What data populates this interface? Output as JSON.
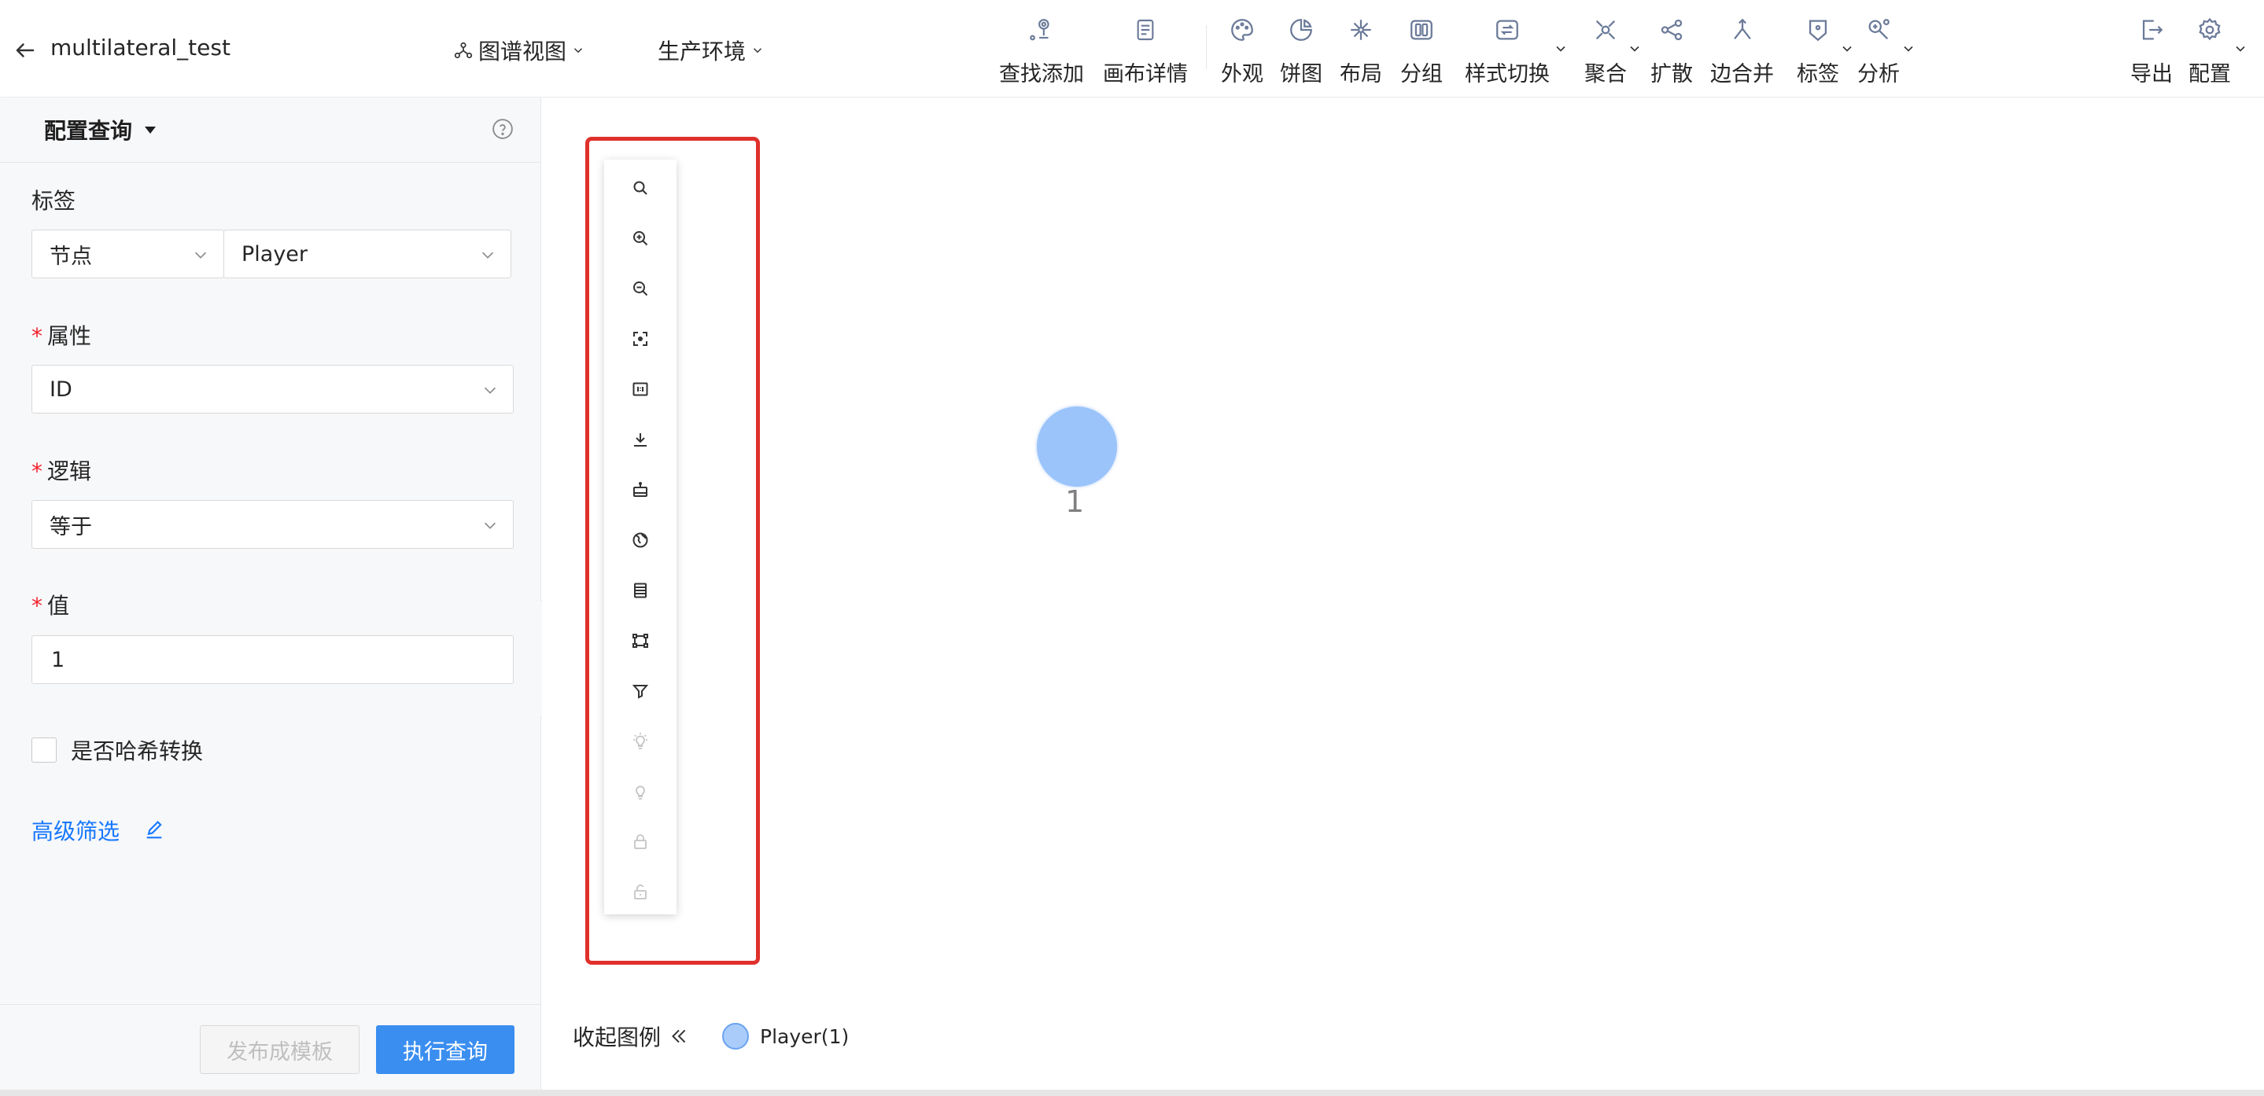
{
  "app": {
    "project_name": "multilateral_test",
    "view_mode": "图谱视图",
    "environment": "生产环境"
  },
  "toolbar": [
    {
      "id": "find-add",
      "label": "查找添加",
      "icon": "pin-icon"
    },
    {
      "id": "canvas-detail",
      "label": "画布详情",
      "icon": "document-icon"
    },
    {
      "id": "appearance",
      "label": "外观",
      "icon": "palette-icon"
    },
    {
      "id": "pie",
      "label": "饼图",
      "icon": "pie-chart-icon"
    },
    {
      "id": "layout",
      "label": "布局",
      "icon": "layout-icon"
    },
    {
      "id": "group",
      "label": "分组",
      "icon": "group-icon"
    },
    {
      "id": "style-switch",
      "label": "样式切换",
      "icon": "switch-icon"
    },
    {
      "id": "aggregate",
      "label": "聚合",
      "icon": "aggregate-icon"
    },
    {
      "id": "expand",
      "label": "扩散",
      "icon": "share-icon"
    },
    {
      "id": "merge-edges",
      "label": "边合并",
      "icon": "merge-icon"
    },
    {
      "id": "tags",
      "label": "标签",
      "icon": "tag-icon"
    },
    {
      "id": "analysis",
      "label": "分析",
      "icon": "analysis-icon"
    },
    {
      "id": "export",
      "label": "导出",
      "icon": "export-icon"
    },
    {
      "id": "settings",
      "label": "配置",
      "icon": "gear-icon"
    }
  ],
  "query_panel": {
    "title": "配置查询",
    "label_field": {
      "label": "标签",
      "type_value": "节点",
      "label_value": "Player"
    },
    "property_field": {
      "label": "属性",
      "value": "ID"
    },
    "logic_field": {
      "label": "逻辑",
      "value": "等于"
    },
    "value_field": {
      "label": "值",
      "value": "1"
    },
    "hash_checkbox": {
      "label": "是否哈希转换",
      "checked": false
    },
    "advanced_filter": "高级筛选",
    "publish_button": "发布成模板",
    "execute_button": "执行查询"
  },
  "canvas_tools": [
    {
      "icon": "search-icon",
      "enabled": true
    },
    {
      "icon": "zoom-in-icon",
      "enabled": true
    },
    {
      "icon": "zoom-out-icon",
      "enabled": true
    },
    {
      "icon": "fit-view-icon",
      "enabled": true
    },
    {
      "icon": "actual-size-icon",
      "enabled": true
    },
    {
      "icon": "download-icon",
      "enabled": true
    },
    {
      "icon": "robot-icon",
      "enabled": true
    },
    {
      "icon": "globe-icon",
      "enabled": true
    },
    {
      "icon": "list-icon",
      "enabled": true
    },
    {
      "icon": "select-frame-icon",
      "enabled": true
    },
    {
      "icon": "filter-icon",
      "enabled": true
    },
    {
      "icon": "lightbulb-on-icon",
      "enabled": false
    },
    {
      "icon": "lightbulb-icon",
      "enabled": false
    },
    {
      "icon": "lock-icon",
      "enabled": false
    },
    {
      "icon": "unlock-icon",
      "enabled": false
    }
  ],
  "graph": {
    "node": {
      "label": "1",
      "color": "#9bc4fb"
    }
  },
  "legend": {
    "toggle_label": "收起图例",
    "items": [
      {
        "label": "Player(1)",
        "color": "#a9ccfb"
      }
    ]
  },
  "colors": {
    "primary": "#3a8ef0",
    "link": "#1677ff",
    "required": "#f5222d",
    "highlight_frame": "#e0302b"
  }
}
